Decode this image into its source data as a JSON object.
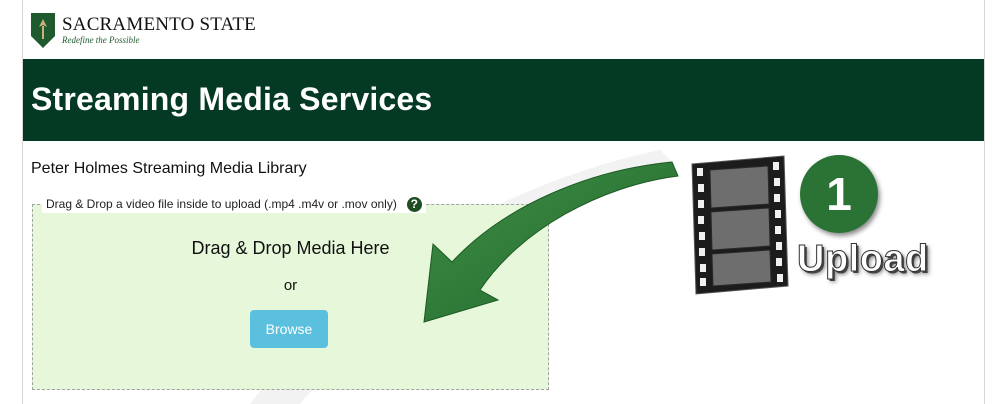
{
  "brand": {
    "name": "SACRAMENTO STATE",
    "tagline": "Redefine the Possible"
  },
  "header": {
    "title": "Streaming Media Services"
  },
  "library": {
    "title": "Peter Holmes Streaming Media Library"
  },
  "upload": {
    "legend": "Drag & Drop a video file inside to upload (.mp4 .m4v or .mov only)",
    "help_symbol": "?",
    "drop_title": "Drag & Drop Media Here",
    "or_text": "or",
    "browse_label": "Browse"
  },
  "callout": {
    "step_number": "1",
    "step_label": "Upload"
  },
  "colors": {
    "header_bg": "#043a23",
    "dropzone_bg": "#e7f7da",
    "browse_button": "#5bc0de",
    "arrow_green": "#2e7a37",
    "step_circle": "#2b7235"
  }
}
